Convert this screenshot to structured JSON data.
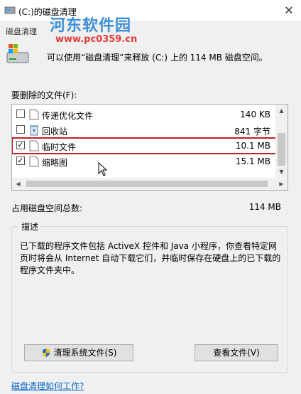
{
  "window": {
    "title": "(C:)的磁盘清理",
    "close_glyph": "✕",
    "app_icon": "disk-cleanup-icon"
  },
  "tab": {
    "label": "磁盘清理"
  },
  "watermark": {
    "line1": "河东软件园",
    "line2": "www.pc0359.cn"
  },
  "intro": {
    "text": "可以使用“磁盘清理”来释放  (C:) 上的 114 MB 磁盘空间。"
  },
  "files_section": {
    "label": "要删除的文件(F):"
  },
  "files": [
    {
      "name": "传递优化文件",
      "size": "140 KB",
      "checked": false,
      "check_glyph": "",
      "icon": "file-icon",
      "highlighted": false
    },
    {
      "name": "回收站",
      "size": "841 字节",
      "checked": false,
      "check_glyph": "",
      "icon": "recycle-bin-icon",
      "highlighted": false
    },
    {
      "name": "临时文件",
      "size": "10.1 MB",
      "checked": true,
      "check_glyph": "✓",
      "icon": "file-icon",
      "highlighted": true
    },
    {
      "name": "缩略图",
      "size": "15.1 MB",
      "checked": true,
      "check_glyph": "✓",
      "icon": "file-icon",
      "highlighted": false
    }
  ],
  "scroll": {
    "up": "▲",
    "down": "▼",
    "left": "◀",
    "right": "▶"
  },
  "total": {
    "label": "占用磁盘空间总数:",
    "value": "114 MB"
  },
  "description": {
    "title": "描述",
    "text": "已下载的程序文件包括 ActiveX 控件和 Java 小程序，你查看特定网页时将会从 Internet 自动下载它们，并临时保存在硬盘上的已下载的程序文件夹中。"
  },
  "buttons": {
    "cleanup_system": "清理系统文件(S)",
    "view_files": "查看文件(V)"
  },
  "help_link": "磁盘清理如何工作?",
  "colors": {
    "highlight": "#c0202a",
    "link": "#0066cc",
    "accent": "#0078d7"
  }
}
